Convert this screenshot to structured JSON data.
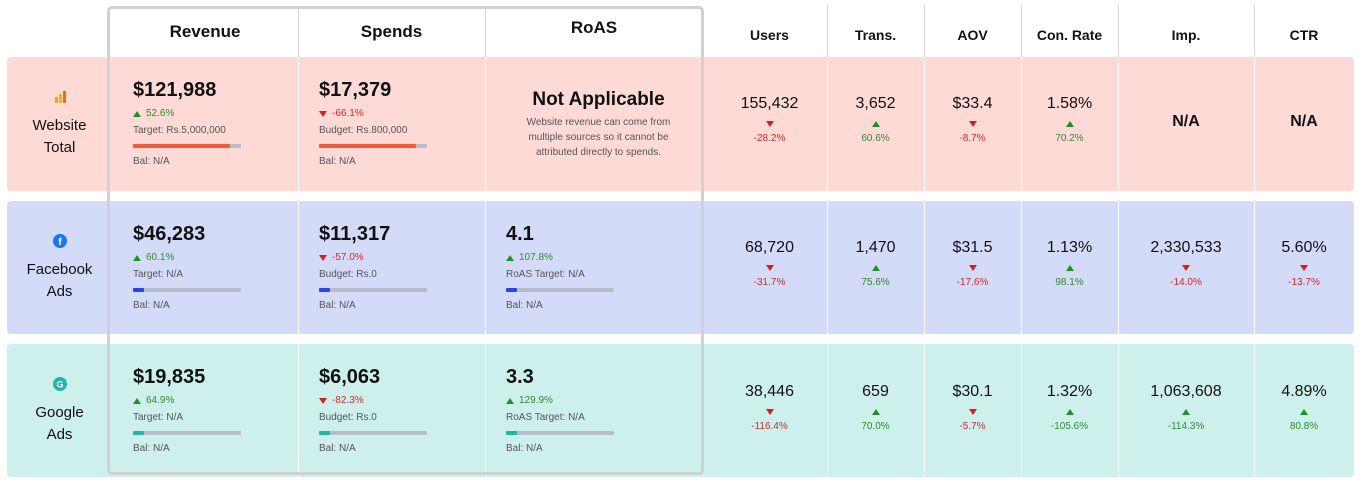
{
  "headers": {
    "revenue": "Revenue",
    "spends": "Spends",
    "roas": "RoAS",
    "users": "Users",
    "trans": "Trans.",
    "aov": "AOV",
    "conrate": "Con. Rate",
    "imp": "Imp.",
    "ctr": "CTR"
  },
  "rows": [
    {
      "label_line1": "Website",
      "label_line2": "Total",
      "icon": "analytics-bar-icon",
      "revenue": {
        "value": "$121,988",
        "change": "52.6%",
        "dir": "up",
        "sub": "Target: Rs.5,000,000",
        "progress": 0.9,
        "bal": "Bal: N/A"
      },
      "spends": {
        "value": "$17,379",
        "change": "-66.1%",
        "dir": "down",
        "sub": "Budget: Rs.800,000",
        "progress": 0.9,
        "bal": "Bal: N/A"
      },
      "roas": {
        "title": "Not Applicable",
        "desc1": "Website revenue can come from",
        "desc2": "multiple sources so it cannot be",
        "desc3": "attributed directly to spends."
      },
      "users": {
        "value": "155,432",
        "change": "-28.2%",
        "dir": "down"
      },
      "trans": {
        "value": "3,652",
        "change": "60.6%",
        "dir": "up"
      },
      "aov": {
        "value": "$33.4",
        "change": "-8.7%",
        "dir": "down"
      },
      "conrate": {
        "value": "1.58%",
        "change": "70.2%",
        "dir": "up"
      },
      "imp": {
        "value": "N/A"
      },
      "ctr": {
        "value": "N/A"
      }
    },
    {
      "label_line1": "Facebook",
      "label_line2": "Ads",
      "icon": "facebook-icon",
      "revenue": {
        "value": "$46,283",
        "change": "60.1%",
        "dir": "up",
        "sub": "Target: N/A",
        "progress": 0.1,
        "bal": "Bal: N/A"
      },
      "spends": {
        "value": "$11,317",
        "change": "-57.0%",
        "dir": "down",
        "sub": "Budget: Rs.0",
        "progress": 0.1,
        "bal": "Bal: N/A"
      },
      "roas": {
        "value": "4.1",
        "change": "107.8%",
        "dir": "up",
        "sub": "RoAS Target: N/A",
        "progress": 0.1,
        "bal": "Bal: N/A"
      },
      "users": {
        "value": "68,720",
        "change": "-31.7%",
        "dir": "down"
      },
      "trans": {
        "value": "1,470",
        "change": "75.6%",
        "dir": "up"
      },
      "aov": {
        "value": "$31.5",
        "change": "-17.6%",
        "dir": "down"
      },
      "conrate": {
        "value": "1.13%",
        "change": "98.1%",
        "dir": "up"
      },
      "imp": {
        "value": "2,330,533",
        "change": "-14.0%",
        "dir": "down"
      },
      "ctr": {
        "value": "5.60%",
        "change": "-13.7%",
        "dir": "down"
      }
    },
    {
      "label_line1": "Google",
      "label_line2": "Ads",
      "icon": "google-ads-icon",
      "revenue": {
        "value": "$19,835",
        "change": "64.9%",
        "dir": "up",
        "sub": "Target: N/A",
        "progress": 0.1,
        "bal": "Bal: N/A"
      },
      "spends": {
        "value": "$6,063",
        "change": "-82.3%",
        "dir": "down",
        "sub": "Budget: Rs.0",
        "progress": 0.1,
        "bal": "Bal: N/A"
      },
      "roas": {
        "value": "3.3",
        "change": "129.9%",
        "dir": "up",
        "sub": "RoAS Target: N/A",
        "progress": 0.1,
        "bal": "Bal: N/A"
      },
      "users": {
        "value": "38,446",
        "change": "-116.4%",
        "dir": "down"
      },
      "trans": {
        "value": "659",
        "change": "70.0%",
        "dir": "up"
      },
      "aov": {
        "value": "$30.1",
        "change": "-5.7%",
        "dir": "down"
      },
      "conrate": {
        "value": "1.32%",
        "change": "-105.6%",
        "dir": "up"
      },
      "imp": {
        "value": "1,063,608",
        "change": "-114.3%",
        "dir": "up"
      },
      "ctr": {
        "value": "4.89%",
        "change": "80.8%",
        "dir": "up"
      }
    }
  ],
  "colors": {
    "website_bg": "#fedad6",
    "facebook_bg": "#d3dbf9",
    "google_bg": "#cdf0ec",
    "website_bar": "#f15a3b",
    "facebook_bar": "#2846e8",
    "google_bar": "#1fb8a3",
    "up": "#2e8b2e",
    "down": "#d12a2a"
  }
}
